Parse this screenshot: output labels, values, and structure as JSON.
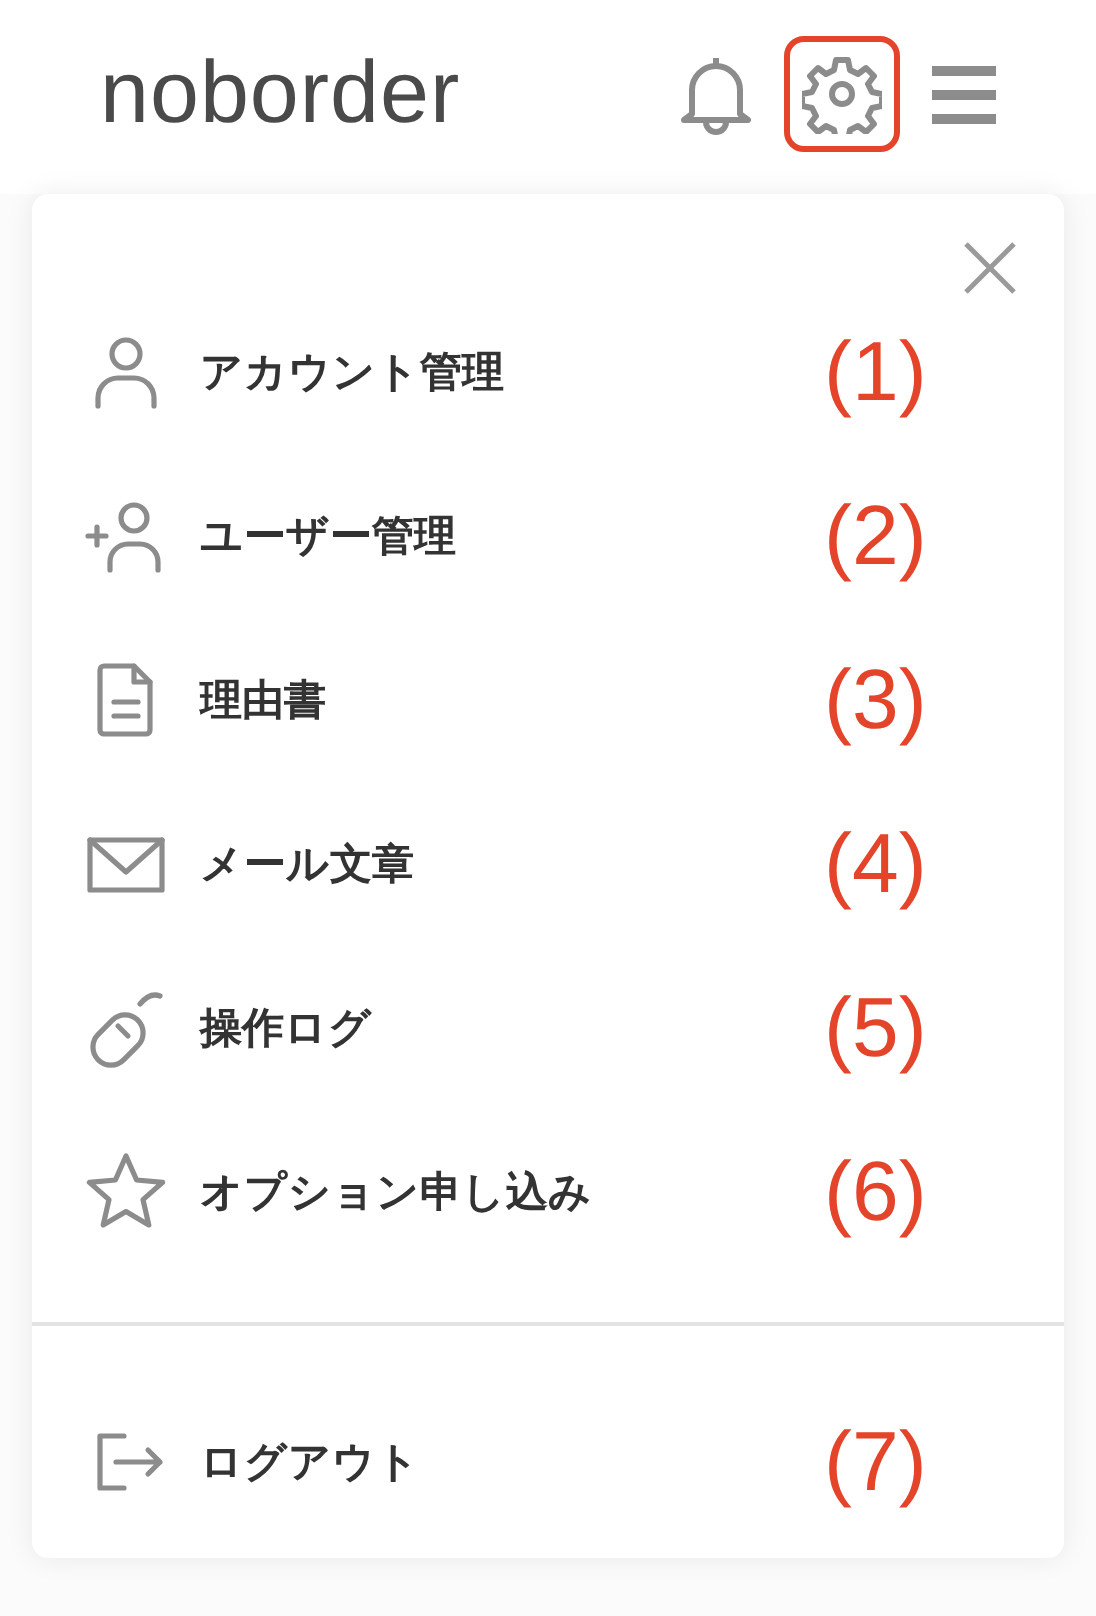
{
  "header": {
    "logo": "noborder",
    "icons": [
      {
        "kind": "bell",
        "highlighted": false
      },
      {
        "kind": "gear",
        "highlighted": true
      },
      {
        "kind": "menu",
        "highlighted": false
      }
    ]
  },
  "menu": {
    "items": [
      {
        "kind": "user",
        "label": "アカウント管理",
        "annotation": "(1)"
      },
      {
        "kind": "user-add",
        "label": "ユーザー管理",
        "annotation": "(2)"
      },
      {
        "kind": "document",
        "label": "理由書",
        "annotation": "(3)"
      },
      {
        "kind": "mail",
        "label": "メール文章",
        "annotation": "(4)"
      },
      {
        "kind": "mouse",
        "label": "操作ログ",
        "annotation": "(5)"
      },
      {
        "kind": "star",
        "label": "オプション申し込み",
        "annotation": "(6)"
      }
    ],
    "logout": {
      "kind": "logout",
      "label": "ログアウト",
      "annotation": "(7)"
    }
  }
}
